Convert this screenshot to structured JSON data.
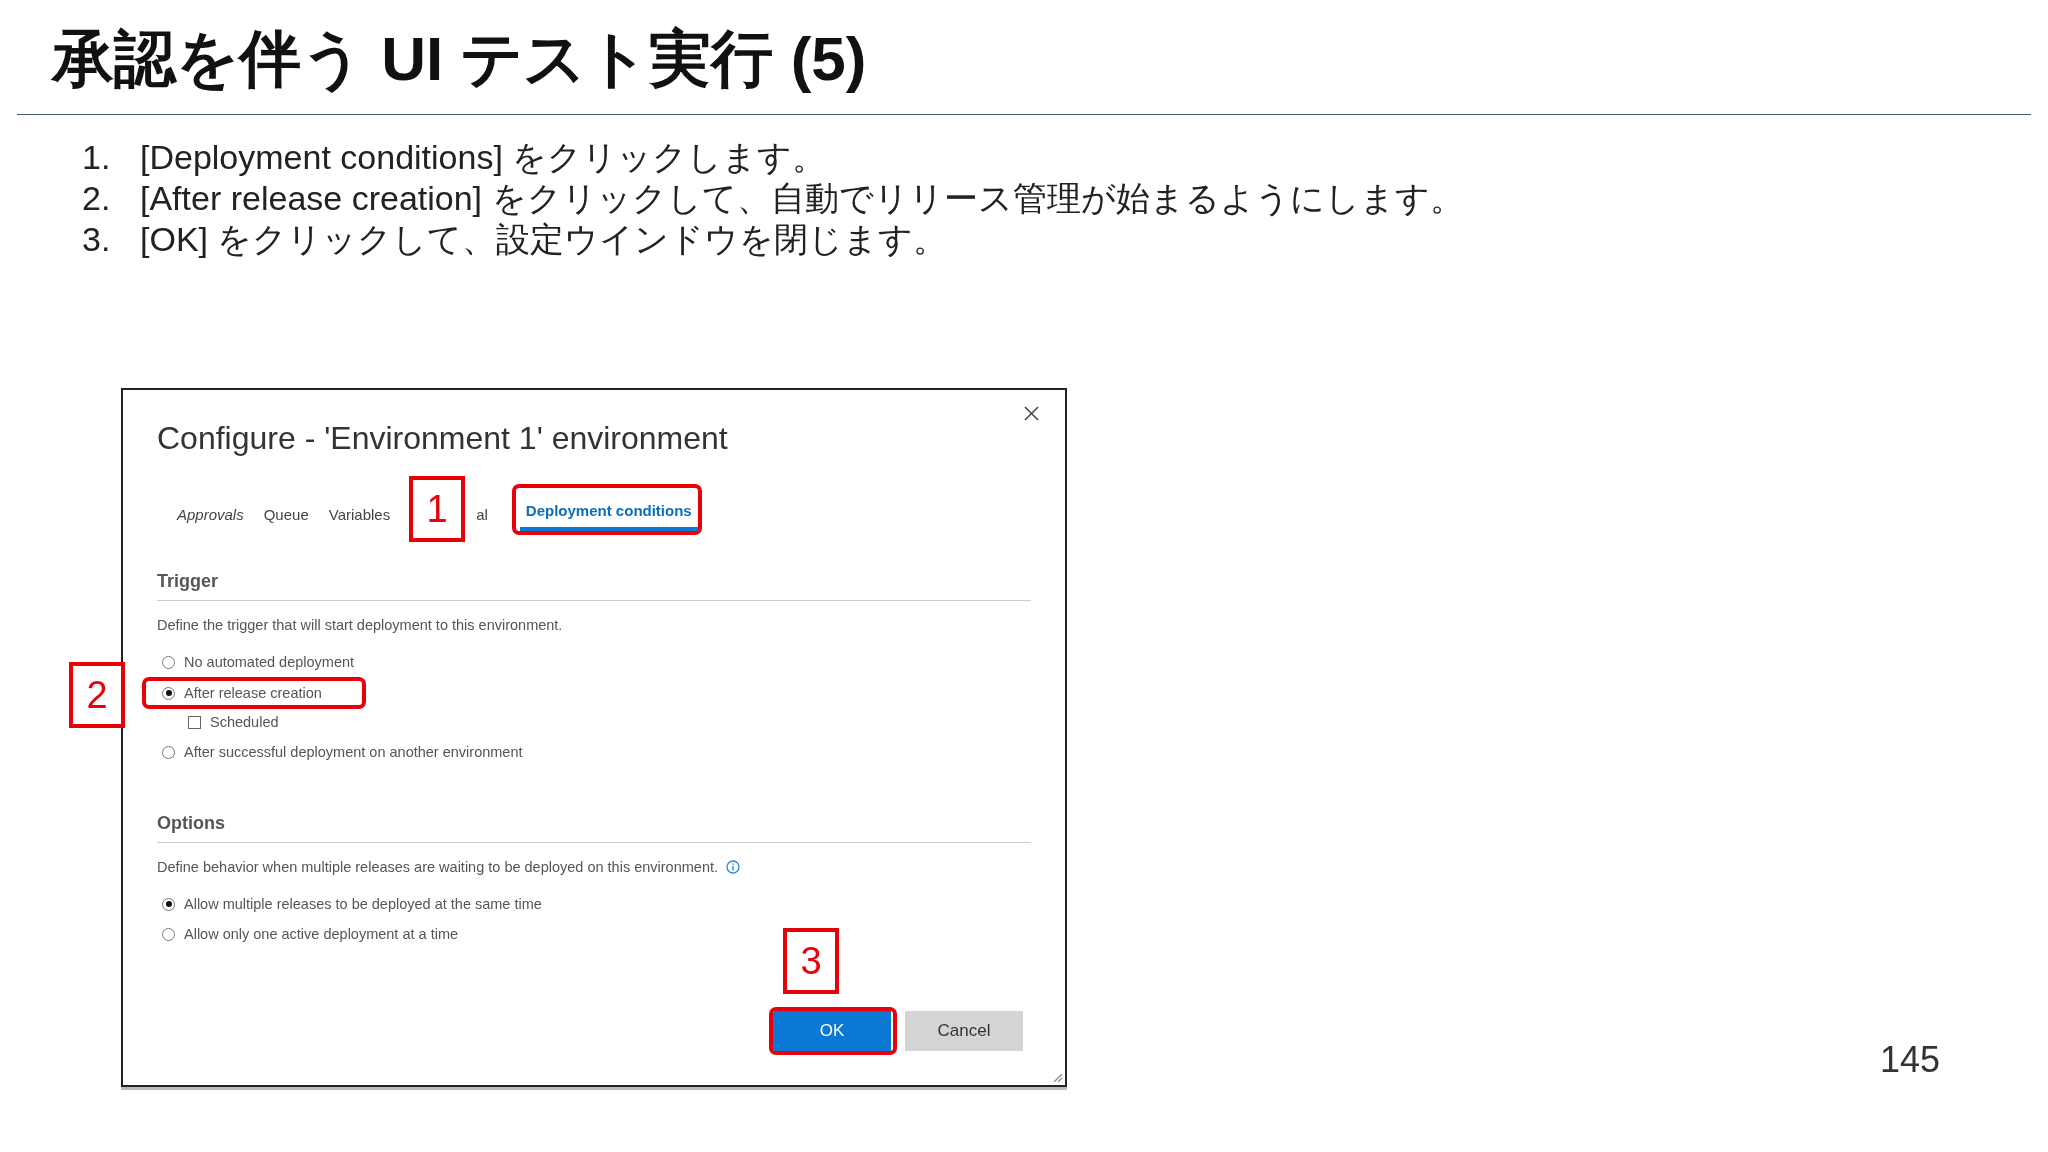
{
  "slide": {
    "title": "承認を伴う UI テスト実行 (5)",
    "steps": [
      {
        "number": "1.",
        "text": "[Deployment conditions] をクリックします。"
      },
      {
        "number": "2.",
        "text": "[After release creation] をクリックして、自動でリリース管理が始まるようにします。"
      },
      {
        "number": "3.",
        "text": "[OK] をクリックして、設定ウインドウを閉じます。"
      }
    ],
    "page_number": "145"
  },
  "dialog": {
    "title": "Configure - 'Environment 1' environment",
    "tabs": [
      {
        "label": "Approvals",
        "selected": false,
        "italic": true,
        "highlighted": false
      },
      {
        "label": "Queue",
        "selected": false,
        "italic": false,
        "highlighted": false
      },
      {
        "label": "Variables",
        "selected": false,
        "italic": false,
        "highlighted": false
      },
      {
        "label": "al",
        "selected": false,
        "italic": false,
        "highlighted": false
      },
      {
        "label": "Deployment conditions",
        "selected": true,
        "italic": false,
        "highlighted": true
      }
    ],
    "sections": [
      {
        "heading": "Trigger",
        "description": "Define the trigger that will start deployment to this environment.",
        "info_icon": false,
        "options": [
          {
            "kind": "radio",
            "label": "No automated deployment",
            "selected": false,
            "highlighted": false
          },
          {
            "kind": "radio",
            "label": "After release creation",
            "selected": true,
            "highlighted": true,
            "children": [
              {
                "kind": "checkbox",
                "label": "Scheduled",
                "checked": false,
                "highlighted": false
              }
            ]
          },
          {
            "kind": "radio",
            "label": "After successful deployment on another environment",
            "selected": false,
            "highlighted": false
          }
        ]
      },
      {
        "heading": "Options",
        "description": "Define behavior when multiple releases are waiting to be deployed on this environment.",
        "info_icon": true,
        "options": [
          {
            "kind": "radio",
            "label": "Allow multiple releases to be deployed at the same time",
            "selected": true,
            "highlighted": false
          },
          {
            "kind": "radio",
            "label": "Allow only one active deployment at a time",
            "selected": false,
            "highlighted": false
          }
        ]
      }
    ],
    "buttons": [
      {
        "label": "OK",
        "kind": "primary",
        "highlighted": true
      },
      {
        "label": "Cancel",
        "kind": "secondary",
        "highlighted": false
      }
    ]
  },
  "callouts": [
    {
      "label": "1"
    },
    {
      "label": "2"
    },
    {
      "label": "3"
    }
  ]
}
